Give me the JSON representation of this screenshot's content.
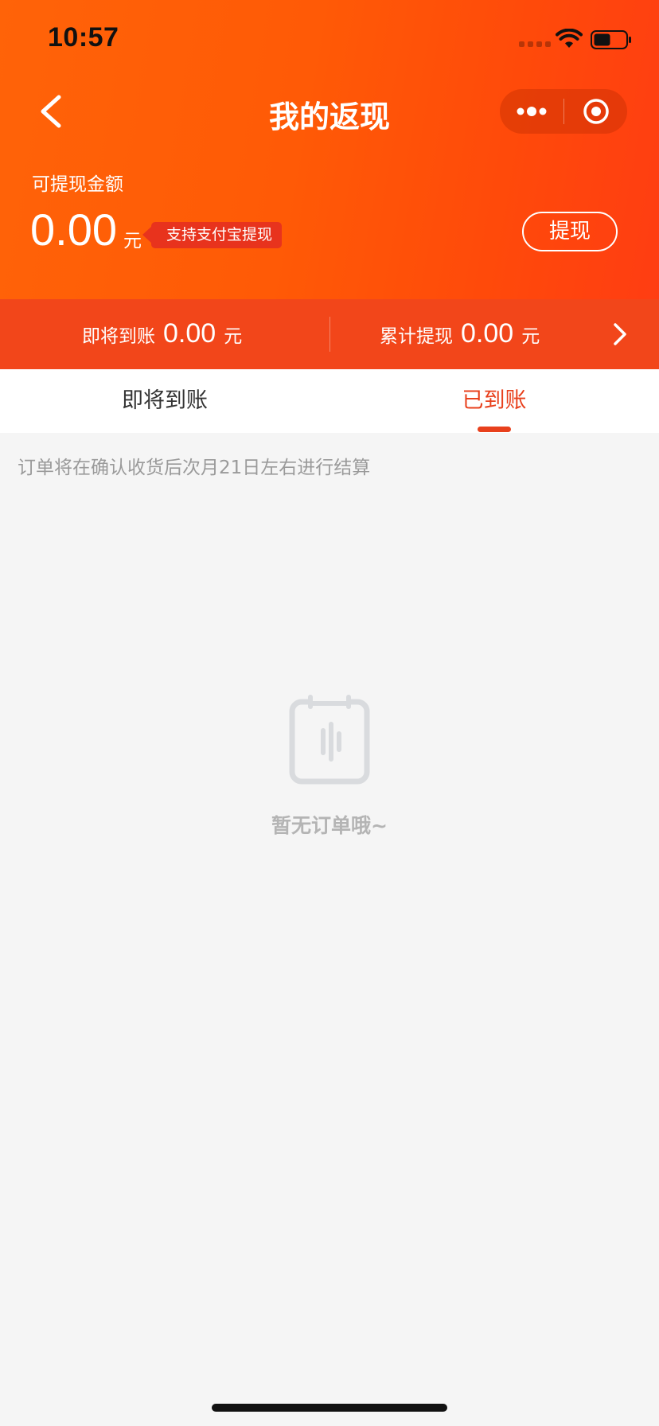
{
  "status_bar": {
    "time": "10:57"
  },
  "nav": {
    "title": "我的返现"
  },
  "balance": {
    "label": "可提现金额",
    "amount": "0.00",
    "unit": "元",
    "alipay_tag": "支持支付宝提现",
    "withdraw_label": "提现"
  },
  "summary": {
    "pending_label": "即将到账",
    "pending_value": "0.00",
    "pending_unit": "元",
    "total_label": "累计提现",
    "total_value": "0.00",
    "total_unit": "元"
  },
  "tabs": {
    "items": [
      {
        "label": "即将到账",
        "active": false
      },
      {
        "label": "已到账",
        "active": true
      }
    ]
  },
  "notice": "订单将在确认收货后次月21日左右进行结算",
  "empty_state": {
    "text": "暂无订单哦~"
  },
  "colors": {
    "header_gradient_start": "#ff6308",
    "header_gradient_end": "#ff3d12",
    "summary_bar": "#f2461a",
    "accent": "#e8401c",
    "background": "#f5f5f5"
  },
  "icons": {
    "back": "chevron-left-icon",
    "more": "more-dots-icon",
    "close": "target-circle-icon",
    "summary_arrow": "chevron-right-icon",
    "empty": "clipboard-icon"
  }
}
